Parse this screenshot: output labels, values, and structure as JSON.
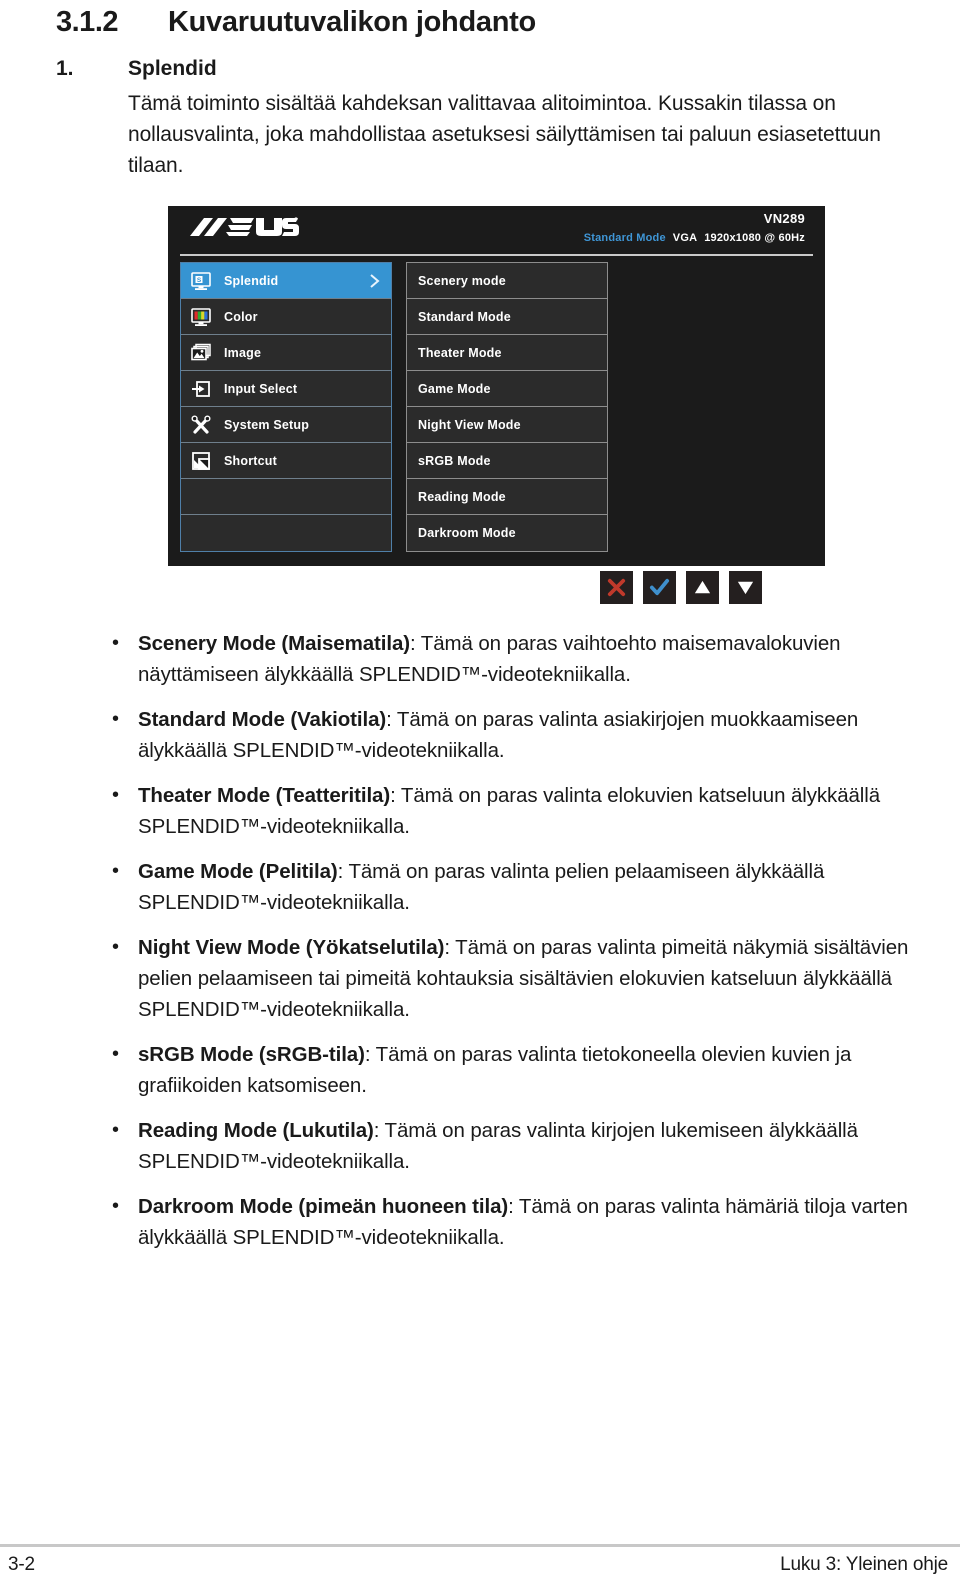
{
  "heading": {
    "number": "3.1.2",
    "title": "Kuvaruutuvalikon johdanto"
  },
  "section": {
    "number": "1.",
    "title": "Splendid",
    "intro": "Tämä toiminto sisältää kahdeksan valittavaa alitoimintoa. Kussakin tilassa on nollausvalinta, joka mahdollistaa asetuksesi säilyttämisen tai paluun esiasetettuun tilaan."
  },
  "osd": {
    "logo": "asus-logo",
    "model": "VN289",
    "status_mode": "Standard Mode",
    "status_source": "VGA",
    "status_resolution": "1920x1080 @ 60Hz",
    "menu": [
      {
        "label": "Splendid",
        "icon": "monitor-splendid-icon",
        "active": true,
        "chevron": "chevron-right-icon"
      },
      {
        "label": "Color",
        "icon": "monitor-color-icon",
        "active": false
      },
      {
        "label": "Image",
        "icon": "picture-icon",
        "active": false
      },
      {
        "label": "Input Select",
        "icon": "input-arrow-icon",
        "active": false
      },
      {
        "label": "System Setup",
        "icon": "wrench-screwdriver-icon",
        "active": false
      },
      {
        "label": "Shortcut",
        "icon": "shortcut-icon",
        "active": false
      },
      {
        "label": "",
        "icon": "",
        "active": false
      },
      {
        "label": "",
        "icon": "",
        "active": false
      }
    ],
    "submenu": [
      "Scenery mode",
      "Standard Mode",
      "Theater Mode",
      "Game Mode",
      "Night View Mode",
      "sRGB Mode",
      "Reading Mode",
      "Darkroom Mode"
    ],
    "buttons": [
      {
        "name": "close-icon",
        "glyph": "✕",
        "color": "#c0392b"
      },
      {
        "name": "check-icon",
        "glyph": "✔",
        "color": "#3f8fcc"
      },
      {
        "name": "triangle-up-icon",
        "glyph": "▲",
        "color": "#ffffff"
      },
      {
        "name": "triangle-down-icon",
        "glyph": "▼",
        "color": "#ffffff"
      }
    ],
    "colors": {
      "panel_bg": "#1b1b1b",
      "row_bg": "#2b2b2b",
      "accent": "#3694d2",
      "border_left": "#4f7fa8",
      "border_right": "#8d8d8d"
    }
  },
  "bullets": [
    {
      "bullet": "•",
      "term": "Scenery Mode (Maisematila)",
      "rest": ": Tämä on paras vaihtoehto maisemavalokuvien näyttämiseen älykkäällä SPLENDID™-videotekniikalla."
    },
    {
      "bullet": "•",
      "term": "Standard Mode (Vakiotila)",
      "rest": ": Tämä on paras valinta asiakirjojen muokkaamiseen älykkäällä SPLENDID™-videotekniikalla."
    },
    {
      "bullet": "•",
      "term": "Theater Mode (Teatteritila)",
      "rest": ": Tämä on paras valinta elokuvien katseluun älykkäällä SPLENDID™-videotekniikalla."
    },
    {
      "bullet": "•",
      "term": "Game Mode (Pelitila)",
      "rest": ": Tämä on paras valinta pelien pelaamiseen älykkäällä SPLENDID™-videotekniikalla."
    },
    {
      "bullet": "•",
      "term": "Night View Mode (Yökatselutila)",
      "rest": ": Tämä on paras valinta pimeitä näkymiä sisältävien pelien pelaamiseen tai pimeitä kohtauksia sisältävien elokuvien katseluun älykkäällä SPLENDID™-videotekniikalla."
    },
    {
      "bullet": "•",
      "term": "sRGB Mode (sRGB-tila)",
      "rest": ": Tämä on paras valinta tietokoneella olevien kuvien ja grafiikoiden katsomiseen."
    },
    {
      "bullet": "•",
      "term": "Reading Mode (Lukutila)",
      "rest": ": Tämä on paras valinta kirjojen lukemiseen älykkäällä SPLENDID™-videotekniikalla."
    },
    {
      "bullet": "•",
      "term": "Darkroom Mode (pimeän huoneen tila)",
      "rest": ": Tämä on paras valinta hämäriä tiloja varten älykkäällä SPLENDID™-videotekniikalla."
    }
  ],
  "footer": {
    "page": "3-2",
    "chapter": "Luku 3: Yleinen ohje"
  }
}
